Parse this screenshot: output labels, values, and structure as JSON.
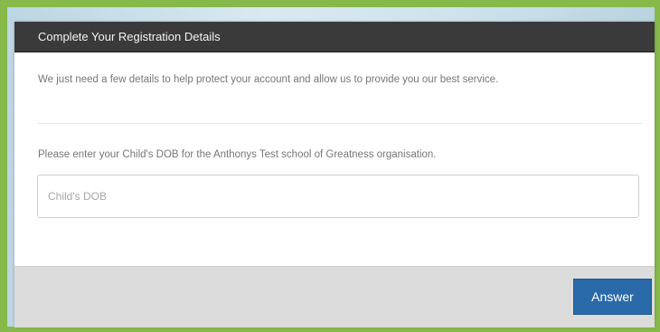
{
  "modal": {
    "title": "Complete Your Registration Details",
    "intro": "We just need a few details to help protect your account and allow us to provide you our best service.",
    "prompt": "Please enter your Child's DOB for the Anthonys Test school of Greatness organisation.",
    "dob_input": {
      "placeholder": "Child's DOB",
      "value": ""
    },
    "answer_button": "Answer"
  },
  "colors": {
    "frame": "#86b94a",
    "header_bg": "#3a3a3a",
    "footer_bg": "#dcdcdc",
    "button_bg": "#2a6aa8"
  }
}
